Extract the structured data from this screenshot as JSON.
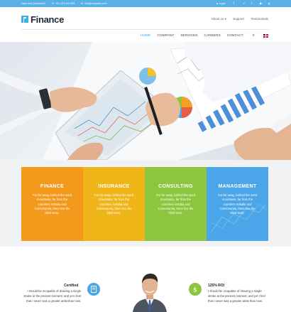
{
  "topbar": {
    "question": "Have any Questions?",
    "phone": "+01 123 444 555",
    "email": "info@company.com",
    "login": "Login",
    "social_icons": [
      "facebook-icon",
      "vine-icon",
      "twitter-icon",
      "youtube-icon",
      "google-plus-icon"
    ]
  },
  "header": {
    "logo_text": "Finance",
    "util_links": [
      "About us",
      "Support",
      "Testimonials"
    ]
  },
  "nav": {
    "items": [
      "HOME",
      "COMPANY",
      "SERVICES",
      "CAREERS",
      "CONTACT"
    ],
    "active": "HOME"
  },
  "services": [
    {
      "title": "FINANCE",
      "text": "Far far away, behind the word mountains, far from the countries Vokalia and Consonantia, there live the blind texts.",
      "color": "#f39a1c"
    },
    {
      "title": "INSURANCE",
      "text": "Far far away, behind the word mountains, far from the countries Vokalia and Consonantia, there live the blind texts.",
      "color": "#efb519"
    },
    {
      "title": "CONSULTING",
      "text": "Far far away, behind the word mountains, far from the countries Vokalia and Consonantia, there live the blind texts.",
      "color": "#8cc63e"
    },
    {
      "title": "MANAGEMENT",
      "text": "Far far away, behind the word mountains, far from the countries Vokalia and Consonantia, there live the blind texts.",
      "color": "#4aa6e8"
    }
  ],
  "features": {
    "left": {
      "title": "Certified",
      "text": "I should be incapable of drawing a single stroke at the present moment; and yet I feel that I never was a greater artist than now."
    },
    "right": {
      "title": "125% ROI",
      "text": "I should be incapable of drawing a single stroke at the present moment; and yet I feel that I never was a greater artist than now."
    }
  },
  "colors": {
    "topbar": "#58b0e6",
    "accent": "#3ca6e6"
  }
}
